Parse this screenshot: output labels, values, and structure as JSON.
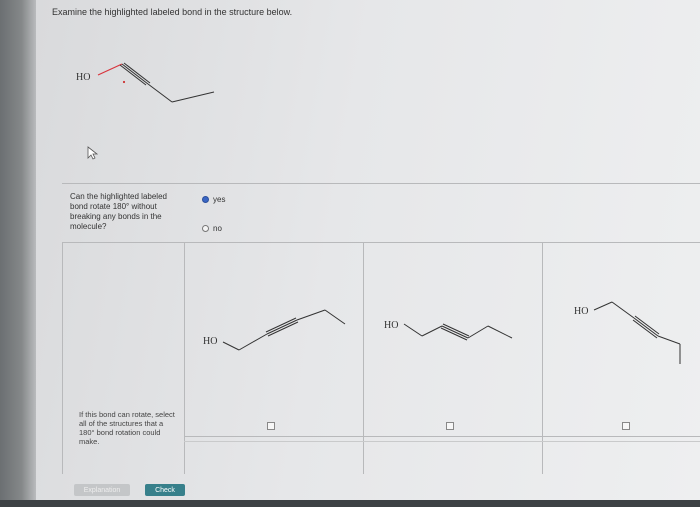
{
  "prompt": "Examine the highlighted labeled bond in the structure below.",
  "molecule_label": "HO",
  "question": {
    "text": "Can the highlighted labeled bond rotate 180° without breaking any bonds in the molecule?",
    "options": [
      {
        "label": "yes",
        "selected": true
      },
      {
        "label": "no",
        "selected": false
      }
    ]
  },
  "instruction": "If this bond can rotate, select all of the structures that a 180° bond rotation could make.",
  "structures": [
    {
      "label": "HO"
    },
    {
      "label": "HO"
    },
    {
      "label": "HO"
    }
  ],
  "buttons": {
    "explanation": "Explanation",
    "check": "Check"
  },
  "colors": {
    "highlight_bond": "#d8343c",
    "radio_selected": "#3a66c4",
    "check_button": "#37808b"
  }
}
